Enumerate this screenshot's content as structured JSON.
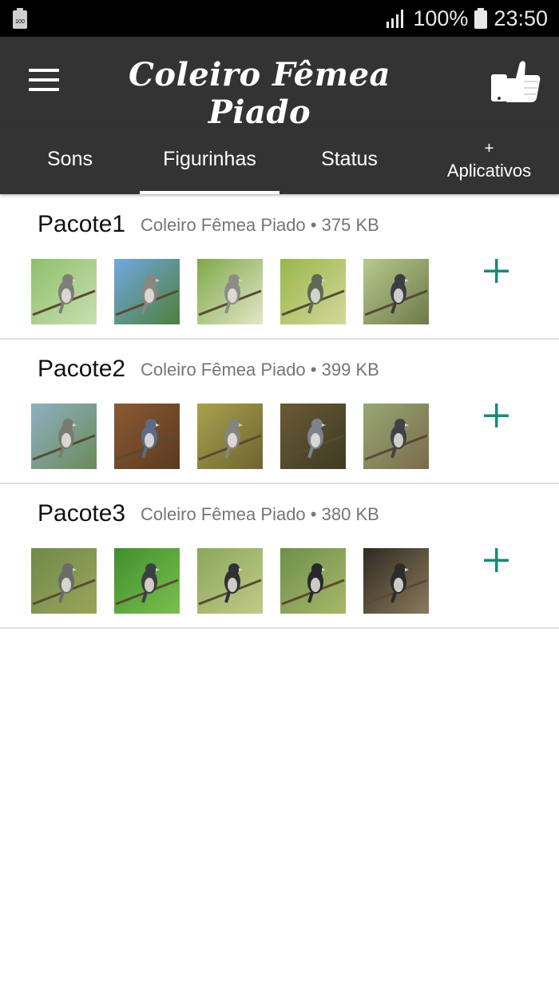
{
  "status_bar": {
    "battery_left_label": "100",
    "battery_percent": "100%",
    "time": "23:50"
  },
  "app_bar": {
    "title": "Coleiro Fêmea Piado",
    "menu_icon": "hamburger-menu-icon",
    "like_icon": "thumbs-up-phone-icon"
  },
  "tabs": [
    {
      "label": "Sons",
      "active": false
    },
    {
      "label": "Figurinhas",
      "active": true
    },
    {
      "label": "Status",
      "active": false
    },
    {
      "plus": "+",
      "label": "Aplicativos",
      "active": false
    }
  ],
  "packs": [
    {
      "name": "Pacote1",
      "author": "Coleiro Fêmea Piado",
      "separator": "•",
      "size": "375 KB",
      "thumbs": [
        {
          "bg1": "#8fbf6a",
          "bg2": "#c9dfb2",
          "bird": "#7d7f78"
        },
        {
          "bg1": "#6fa9e3",
          "bg2": "#4f7f3a",
          "bird": "#8a8680"
        },
        {
          "bg1": "#7fa84a",
          "bg2": "#e3e7c7",
          "bird": "#8d8d86"
        },
        {
          "bg1": "#9ab64a",
          "bg2": "#d3d89a",
          "bird": "#5e6a55"
        },
        {
          "bg1": "#b7c98c",
          "bg2": "#6d7a4a",
          "bird": "#3b3e45"
        }
      ]
    },
    {
      "name": "Pacote2",
      "author": "Coleiro Fêmea Piado",
      "separator": "•",
      "size": "399 KB",
      "thumbs": [
        {
          "bg1": "#8eb0c2",
          "bg2": "#6a8a5a",
          "bird": "#7a7a74"
        },
        {
          "bg1": "#8a5a34",
          "bg2": "#5a3a1f",
          "bird": "#5d6a86"
        },
        {
          "bg1": "#a9a14e",
          "bg2": "#6e6430",
          "bird": "#86857c"
        },
        {
          "bg1": "#6a5a36",
          "bg2": "#3e3a22",
          "bird": "#7c8290"
        },
        {
          "bg1": "#97a874",
          "bg2": "#7a6a4a",
          "bird": "#3f4248"
        }
      ]
    },
    {
      "name": "Pacote3",
      "author": "Coleiro Fêmea Piado",
      "separator": "•",
      "size": "380 KB",
      "thumbs": [
        {
          "bg1": "#6f8a4a",
          "bg2": "#9aa45a",
          "bird": "#6c6c66"
        },
        {
          "bg1": "#3f8f2e",
          "bg2": "#7cbf4e",
          "bird": "#3c3f44"
        },
        {
          "bg1": "#8aa85a",
          "bg2": "#c2c98a",
          "bird": "#2f3136"
        },
        {
          "bg1": "#6e8f4a",
          "bg2": "#a7b86a",
          "bird": "#26282c"
        },
        {
          "bg1": "#2f2a22",
          "bg2": "#8a7a5a",
          "bird": "#2c2c2c"
        }
      ]
    }
  ],
  "colors": {
    "status_bar": "#000000",
    "app_bar": "#333333",
    "accent_add": "#1a8a7a",
    "divider": "#e0e0e0",
    "meta_text": "#757575"
  }
}
